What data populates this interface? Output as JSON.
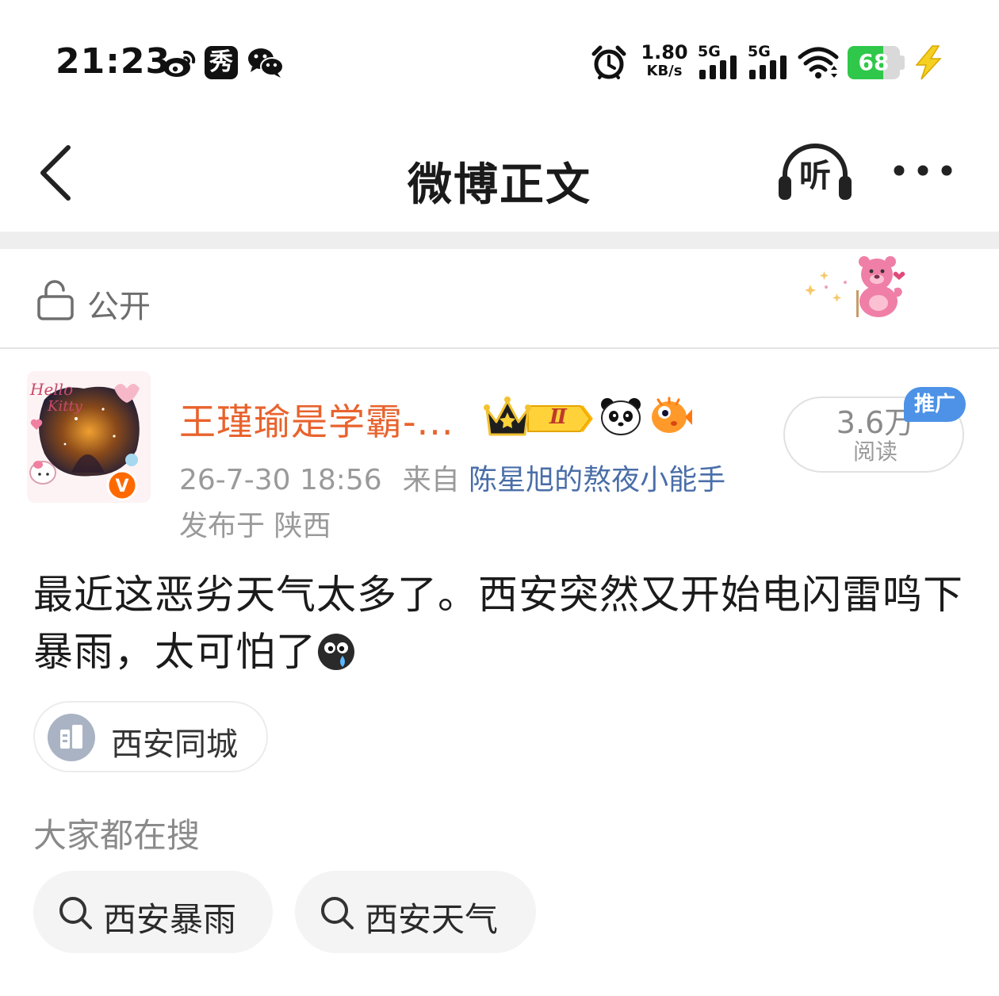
{
  "status_bar": {
    "time": "21:23",
    "net_speed_value": "1.80",
    "net_speed_unit": "KB/s",
    "sim1_label": "5G",
    "sim2_label": "5G",
    "battery_level": "68",
    "battery_fraction": 0.68,
    "left_icons": [
      "weibo-icon",
      "xiu-app-icon",
      "wechat-icon"
    ],
    "right_icons": [
      "alarm-icon",
      "signal-icon",
      "signal-icon",
      "wifi-icon",
      "battery-icon",
      "charging-bolt-icon"
    ],
    "xiu_glyph": "秀"
  },
  "nav": {
    "title": "微博正文",
    "listen_label": "听",
    "back_icon": "chevron-left-icon",
    "more_icon": "more-dots-icon"
  },
  "visibility": {
    "label": "公开",
    "icon": "lock-open-icon"
  },
  "post": {
    "author_name": "王瑾瑜是学霸-...",
    "level_badge": "Ⅱ",
    "timestamp": "26-7-30 18:56",
    "source_prefix": "来自",
    "source_name": "陈星旭的熬夜小能手",
    "location": "发布于 陕西",
    "reads_count": "3.6万",
    "reads_label": "阅读",
    "promo_tag": "推广",
    "verified_mark": "V",
    "body_text": "最近这恶劣天气太多了。西安突然又开始电闪雷鸣下暴雨，太可怕了",
    "topic_chip": "西安同城"
  },
  "search": {
    "heading": "大家都在搜",
    "chips": [
      {
        "label": "西安暴雨"
      },
      {
        "label": "西安天气"
      }
    ]
  },
  "colors": {
    "author_orange": "#e8632d",
    "link_blue": "#4a6ea8",
    "battery_green": "#2fc84a",
    "promo_blue": "#4d92e6"
  }
}
